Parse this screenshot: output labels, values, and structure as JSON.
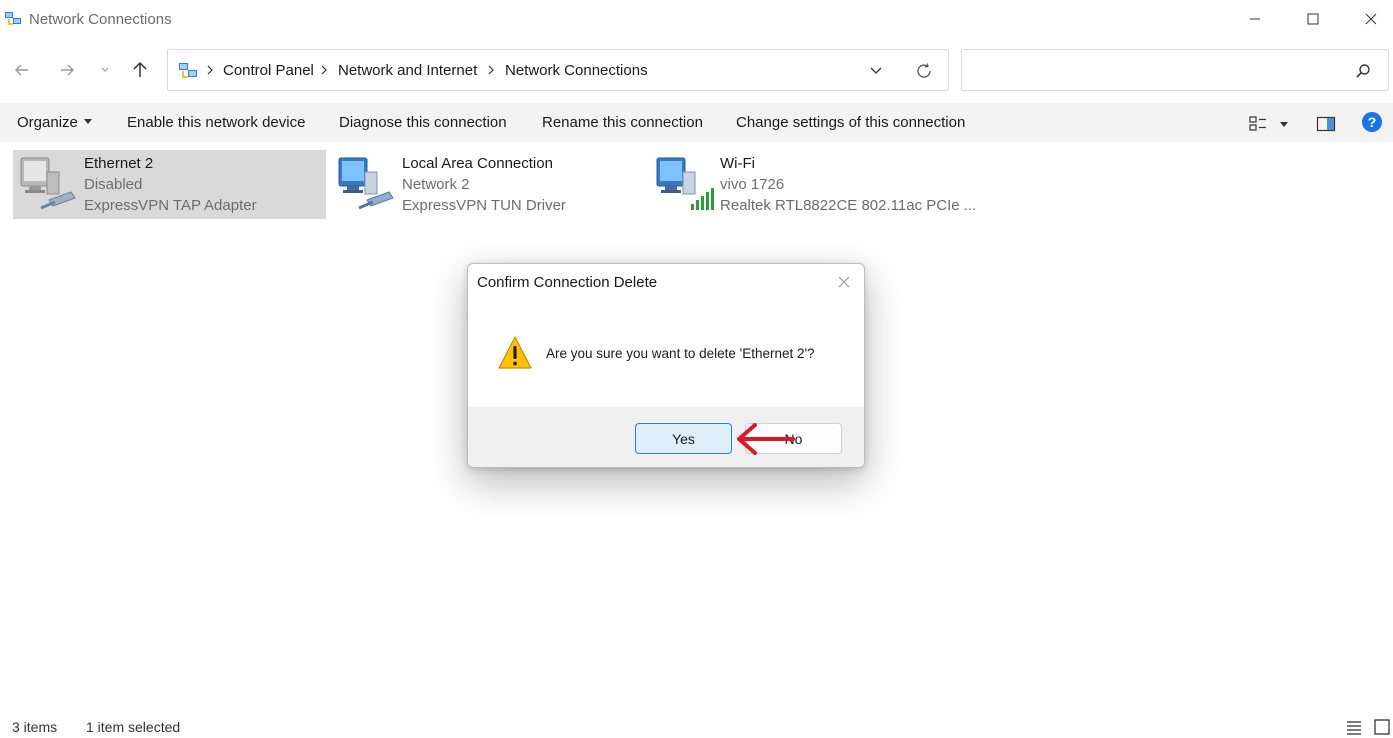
{
  "window": {
    "title": "Network Connections"
  },
  "address": {
    "crumbs": [
      "Control Panel",
      "Network and Internet",
      "Network Connections"
    ]
  },
  "search": {
    "placeholder": "",
    "value": ""
  },
  "toolbar": {
    "organize": "Organize",
    "enable": "Enable this network device",
    "diagnose": "Diagnose this connection",
    "rename": "Rename this connection",
    "change": "Change settings of this connection"
  },
  "items": [
    {
      "name": "Ethernet 2",
      "status": "Disabled",
      "device": "ExpressVPN TAP Adapter",
      "icon": "ethernet-disabled-icon"
    },
    {
      "name": "Local Area Connection",
      "status": "Network 2",
      "device": "ExpressVPN TUN Driver",
      "icon": "ethernet-icon"
    },
    {
      "name": "Wi-Fi",
      "status": "vivo 1726",
      "device": "Realtek RTL8822CE 802.11ac PCIe ...",
      "icon": "wifi-icon"
    }
  ],
  "statusbar": {
    "count": "3 items",
    "selected": "1 item selected"
  },
  "dialog": {
    "title": "Confirm Connection Delete",
    "message": "Are you sure you want to delete 'Ethernet 2'?",
    "yes": "Yes",
    "no": "No"
  },
  "colors": {
    "accent": "#2a7cd6",
    "help": "#1a73e8",
    "selection": "#d9d9d9",
    "annotation_arrow": "#d6182a"
  }
}
